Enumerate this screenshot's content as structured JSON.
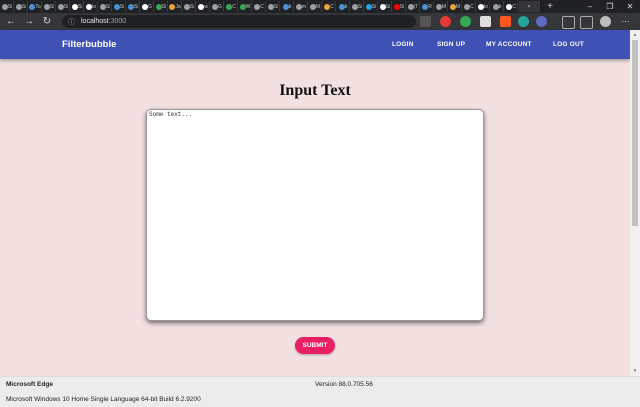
{
  "browser": {
    "tabs": [
      {
        "label": "Si",
        "color": "#9aa0a6"
      },
      {
        "label": "Si",
        "color": "#9aa0a6"
      },
      {
        "label": "To",
        "color": "#4a90d9"
      },
      {
        "label": "Si",
        "color": "#9aa0a6"
      },
      {
        "label": "Si",
        "color": "#9aa0a6"
      },
      {
        "label": "Si",
        "color": "#ffffff"
      },
      {
        "label": "Io",
        "color": "#ffffff"
      },
      {
        "label": "Si",
        "color": "#9aa0a6"
      },
      {
        "label": "Si",
        "color": "#4a90d9"
      },
      {
        "label": "Si",
        "color": "#4a90d9"
      },
      {
        "label": "G",
        "color": "#ffffff"
      },
      {
        "label": "Si",
        "color": "#34a853"
      },
      {
        "label": "Ja",
        "color": "#e8a33d"
      },
      {
        "label": "Si",
        "color": "#9aa0a6"
      },
      {
        "label": "w",
        "color": "#ffffff"
      },
      {
        "label": "G",
        "color": "#9aa0a6"
      },
      {
        "label": "C",
        "color": "#34a853"
      },
      {
        "label": "W",
        "color": "#34a853"
      },
      {
        "label": "C",
        "color": "#9aa0a6"
      },
      {
        "label": "Si",
        "color": "#9aa0a6"
      },
      {
        "label": "b",
        "color": "#4a90d9"
      },
      {
        "label": "m",
        "color": "#9aa0a6"
      },
      {
        "label": "M",
        "color": "#9aa0a6"
      },
      {
        "label": "C",
        "color": "#e8a33d"
      },
      {
        "label": "b",
        "color": "#4a90d9"
      },
      {
        "label": "Si",
        "color": "#9aa0a6"
      },
      {
        "label": "Si",
        "color": "#1da1f2"
      },
      {
        "label": "Si",
        "color": "#ffffff"
      },
      {
        "label": "Si",
        "color": "#ff0000"
      },
      {
        "label": "(T",
        "color": "#9aa0a6"
      },
      {
        "label": "R",
        "color": "#4a90d9"
      },
      {
        "label": "M",
        "color": "#9aa0a6"
      },
      {
        "label": "M",
        "color": "#e8a33d"
      },
      {
        "label": "C",
        "color": "#9aa0a6"
      },
      {
        "label": "lo",
        "color": "#ffffff"
      },
      {
        "label": "b",
        "color": "#9aa0a6"
      },
      {
        "label": "C",
        "color": "#ffffff"
      }
    ],
    "active_tab_close": "×",
    "new_tab": "+",
    "window_controls": {
      "minimize": "–",
      "maximize": "❐",
      "close": "✕"
    },
    "nav": {
      "back": "←",
      "forward": "→",
      "reload": "↻"
    },
    "address": {
      "host": "localhost",
      "port": ":3000",
      "info_icon": "ⓘ"
    }
  },
  "app": {
    "brand": "Filterbubble",
    "nav_links": {
      "login": "LOGIN",
      "signup": "SIGN UP",
      "account": "MY ACCOUNT",
      "logout": "LOG OUT"
    },
    "colors": {
      "appbar": "#3f51b5",
      "submit": "#e91e63",
      "page_bg": "#f3e0e1"
    }
  },
  "main": {
    "heading": "Input Text",
    "textarea_placeholder": "Some text...",
    "submit_label": "SUBMIT"
  },
  "statusbar": {
    "app_name": "Microsoft Edge",
    "version": "Version 88.0.705.56",
    "os": "Microsoft Windows 10 Home Single Language 64-bit Build 6.2.9200"
  }
}
